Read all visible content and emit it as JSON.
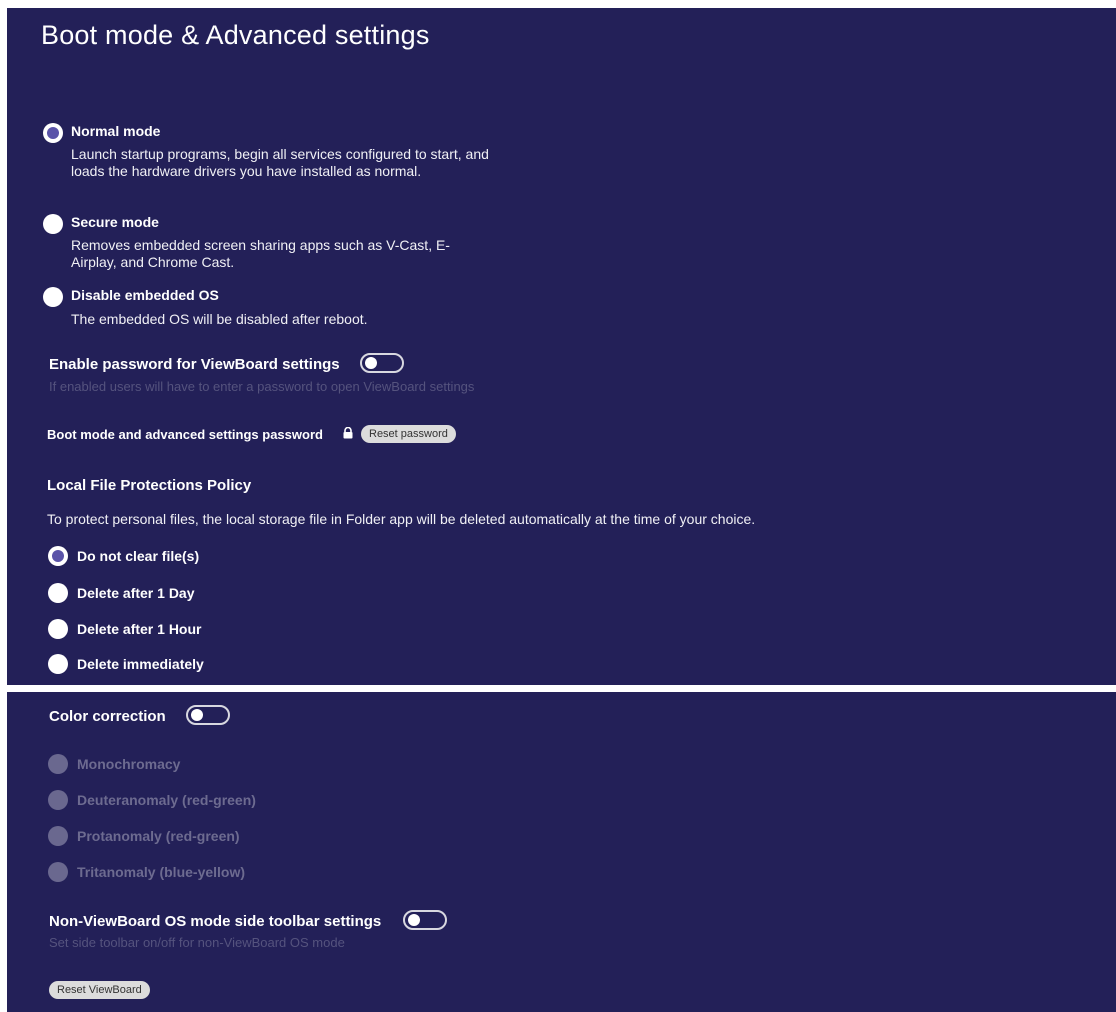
{
  "page": {
    "title": "Boot mode & Advanced settings"
  },
  "boot_modes": [
    {
      "label": "Normal mode",
      "description": "Launch startup programs, begin all services configured to start, and loads the hardware drivers you have installed as normal.",
      "selected": true
    },
    {
      "label": "Secure mode",
      "description": "Removes embedded screen sharing apps such as V-Cast, E-Airplay, and Chrome Cast.",
      "selected": false
    },
    {
      "label": "Disable embedded OS",
      "description": "The embedded OS will be disabled after reboot.",
      "selected": false
    }
  ],
  "password_setting": {
    "label": "Enable password for ViewBoard settings",
    "hint": "If enabled users will have to enter a password to open ViewBoard settings",
    "enabled": false
  },
  "boot_password": {
    "label": "Boot mode and advanced settings password",
    "icon": "lock-icon",
    "reset_label": "Reset password"
  },
  "file_policy": {
    "heading": "Local File Protections Policy",
    "description": "To protect personal files, the local storage file in Folder app will be deleted automatically at the time of your choice.",
    "options": [
      {
        "label": "Do not clear file(s)",
        "selected": true
      },
      {
        "label": "Delete after 1 Day",
        "selected": false
      },
      {
        "label": "Delete after 1 Hour",
        "selected": false
      },
      {
        "label": "Delete immediately",
        "selected": false
      }
    ]
  },
  "color_correction": {
    "label": "Color correction",
    "enabled": false,
    "options": [
      {
        "label": "Monochromacy"
      },
      {
        "label": "Deuteranomaly (red-green)"
      },
      {
        "label": "Protanomaly (red-green)"
      },
      {
        "label": "Tritanomaly (blue-yellow)"
      }
    ]
  },
  "side_toolbar": {
    "label": "Non-ViewBoard OS mode side toolbar settings",
    "hint": "Set side toolbar on/off for non-ViewBoard OS mode",
    "enabled": false
  },
  "reset": {
    "label": "Reset ViewBoard"
  },
  "colors": {
    "panel_bg": "#232058",
    "radio_checked": "#5a53a8",
    "disabled": "#6a688f"
  }
}
